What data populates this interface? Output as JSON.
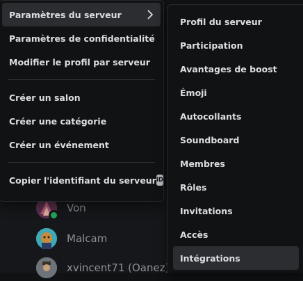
{
  "members": [
    {
      "name": "Von",
      "avatar_color": "#6b3a5a",
      "online": true
    },
    {
      "name": "Malcam",
      "avatar_color": "#3fa7b5",
      "online": false
    },
    {
      "name": "xvincent71 (Oanez)",
      "avatar_color": "#7a7f86",
      "online": false
    }
  ],
  "context_menu": {
    "server_settings": "Paramètres du serveur",
    "privacy_settings": "Paramètres de confidentialité",
    "edit_server_profile": "Modifier le profil par serveur",
    "create_channel": "Créer un salon",
    "create_category": "Créer une catégorie",
    "create_event": "Créer un événement",
    "copy_server_id": "Copier l'identifiant du serveur",
    "id_badge": "ID"
  },
  "submenu": {
    "items": [
      "Profil du serveur",
      "Participation",
      "Avantages de boost",
      "Émoji",
      "Autocollants",
      "Soundboard",
      "Membres",
      "Rôles",
      "Invitations",
      "Accès",
      "Intégrations"
    ]
  },
  "colors": {
    "menu_bg": "#111214",
    "hover_bg": "#2b2d31",
    "text": "#dbdee1",
    "online": "#23a55a"
  }
}
